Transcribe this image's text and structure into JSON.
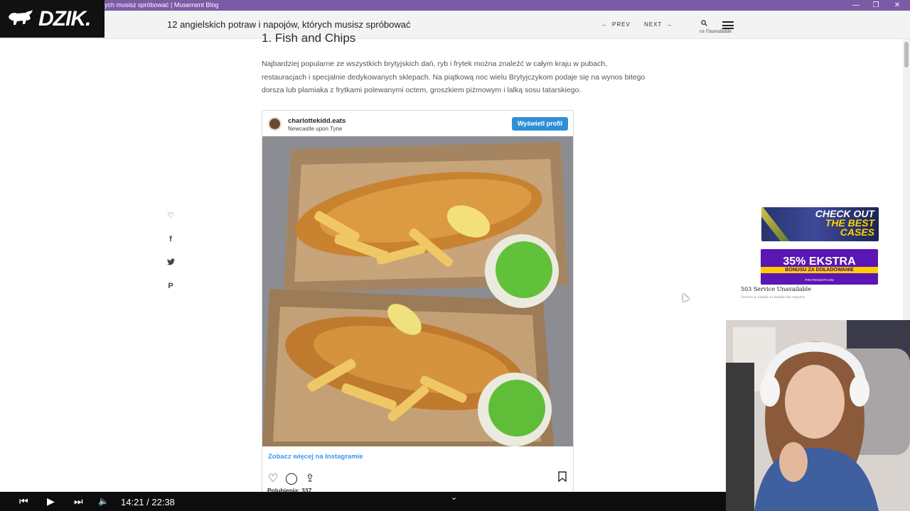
{
  "window": {
    "tab_title": "ych musisz spróbować | Musement Blog",
    "controls": {
      "minimize": "—",
      "restore": "❐",
      "close": "✕"
    }
  },
  "logo": {
    "text": "DZIK.",
    "icon": "bull-icon"
  },
  "header": {
    "page_title": "12 angielskich potraw i napojów, których musisz spróbować",
    "prev_label": "PREV",
    "next_label": "NEXT",
    "prev_arrow": "←",
    "next_arrow": "→",
    "search_icon": "search-icon",
    "mini_error": "ce Unavailable",
    "menu_icon": "hamburger-icon"
  },
  "article": {
    "heading": "1. Fish and Chips",
    "paragraph": "Najbardziej popularne ze wszystkich brytyjskich dań, ryb i frytek można znaleźć w całym kraju w pubach, restauracjach i specjalnie dedykowanych sklepach. Na piątkową noc wielu Brytyjczykom podaje się na wynos bitego dorsza lub plamiaka z frytkami polewanymi octem, groszkiem piżmowym i lalką sosu tatarskiego."
  },
  "social": {
    "like": "♡",
    "facebook": "f",
    "twitter": "🐦",
    "pinterest": "P"
  },
  "instagram": {
    "username": "charlottekidd.eats",
    "location": "Newcastle upon Tyne",
    "profile_button": "Wyświetl profil",
    "see_more": "Zobacz więcej na Instagramie",
    "likes": "Polubienia: 337",
    "icons": {
      "heart": "♡",
      "comment": "◯",
      "share": "⇪",
      "bookmark": "🔖"
    }
  },
  "ads": {
    "ad1_line1": "CHECK OUT",
    "ad1_line2": "THE BEST",
    "ad1_line3": "CASES",
    "ad2_big": "35% EKSTRA",
    "ad2_small": "BONUSU ZA DOŁADOWANIE",
    "ad2_site": "PIRATESWAP.COM"
  },
  "error_widget": {
    "title": "503 Service Unavailable",
    "subtitle": "Service is unable to handle the request"
  },
  "player": {
    "prev_icon": "⏮",
    "play_icon": "▶",
    "next_icon": "⏭",
    "volume_icon": "🔈",
    "time": "14:21 / 22:38",
    "chevron": "⌄"
  }
}
